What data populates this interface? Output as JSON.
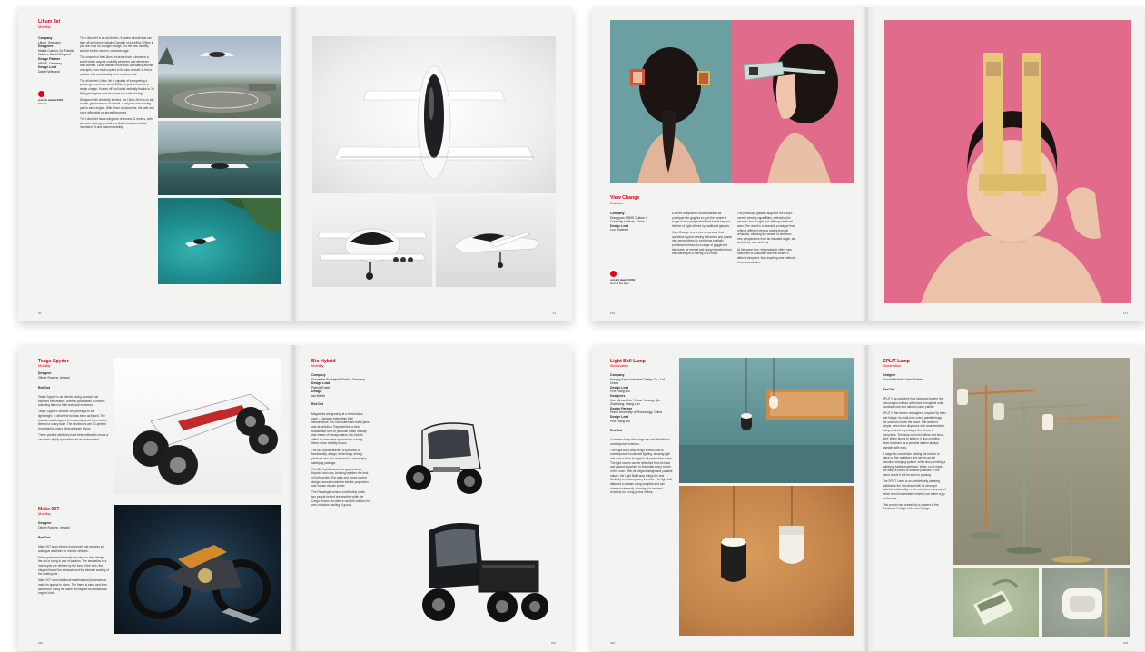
{
  "spreads": {
    "lilium": {
      "title": "Lilium Jet",
      "category": "Mobility",
      "meta": [
        {
          "label": "Company",
          "value": "Lilium, Germany"
        },
        {
          "label": "Designers",
          "value": "Mattia Cosson, Dr. Patrick Nathen, David Wiegand"
        },
        {
          "label": "Design Partner",
          "value": "HPWE, Germany"
        },
        {
          "label": "Design Lead",
          "value": "Daniel Wiegand"
        }
      ],
      "award": {
        "text": "red dot award 2019",
        "sub": "Mobility"
      },
      "paragraphs": [
        "The Lilium Jet is an all-electric, 5-seater aircraft that can take off and land vertically. Capable of travelling 300km in just one hour on a single charge, it is the new mobility service for the modern, urbanised age.",
        "The concept of the Lilium Jet arose from a dream of a world where anyone could fly wherever and whenever they wanted. Lilium wanted more than 36 rotating aircraft concepts, from multi-copters to tilt-rotor aircraft, to find a solution that could satisfy their requirements.",
        "The all-electric Lilium Jet is capable of transporting 4 passengers and one cover 300km in just an hour on a single charge. It takes off and lands vertically thanks to 36 tilting jet engines spread across two sets of wings.",
        "Designed with simplicity in mind, the Lilium Jet has no tail, rudder, gearboxes or oil circuits. It only has one moving part in each engine. With fewer components, the safe and more affordable an aircraft becomes.",
        "The Lilium Jet has a wingspan of around 11 metres, with two sets of wings providing a distinct look as well as increased lift and manoeuvrability."
      ],
      "folio_left": "40",
      "folio_right": "41"
    },
    "view_change": {
      "title": "View Change",
      "category": "Fashion",
      "meta": [
        {
          "label": "Company",
          "value": "Dongguan SWIIS Culture & Creativity Institute, China"
        },
        {
          "label": "Design Lead",
          "value": "Luo Shuzhen"
        }
      ],
      "award": {
        "text": "red dot award 2019",
        "sub": "best of the best"
      },
      "paragraphs_a": [
        "A series of eyewear conceptualised as prototype-like goggles to give the wearer a range of new perspectives that break beyond the line of sight offered by traditional glasses.",
        "View Change is a series of eyewear that questions typical viewing behaviour and grants new perspectives by combining spatially positioned mirrors. In a range of goggle-like structures for mental and design travelled from the challenges of seeing in a crowd."
      ],
      "paragraphs_b": [
        "The periscope glasses augment the body's normal viewing capabilities, extending the wearer's line of sight and offering additional axes. The result is a wearable prototype that reflects different viewing angles through refraction, allowing the wearer to see from new perspectives from an elevated angle, as well as the side and rear.",
        "At the same time, the prototype offers new observers to associate with the wearer's altered viewpoint, thus inspiring new methods of communication."
      ],
      "folio_left": "170",
      "folio_right": "171"
    },
    "mobility_concepts": {
      "items": [
        {
          "title": "Teage Spyder",
          "category": "Mobility",
          "meta": [
            {
              "label": "Designer",
              "value": "Olivier Rosenn, Ireland"
            }
          ],
          "red_dot": "Red Dot",
          "paragraphs": [
            "Teage Spyder is an electric racing concept that explores the creative, thermal possibilities of electric racketing taken to their technical extremes.",
            "Teage Spyder's number one priority is to be lightweight, in which the fun has been achieved. The chassis was designed to be aerodynamic from carbon fibre on a rotary base. The wishbones are 3D-printed from titanium using electron beam fusion.",
            "These positive attributes have been utilised to create a car that is highly specialised for its environment."
          ]
        },
        {
          "title": "Make 007",
          "category": "Mobility",
          "meta": [
            {
              "label": "Designer",
              "value": "Olivier Rosenn, Ireland"
            }
          ],
          "red_dot": "Red Dot",
          "paragraphs": [
            "Make 007 is an electric motorcycle that explores an analogue aesthetic for electric vehicles.",
            "Motorcycles are inherently evocative in their design, the act of riding is one of passion. The aesthetics of a motorcycle are defined by the form of the tank, the elegant flow of the exhausts and the intricate seating of the seating line.",
            "Make 007 uses traditional materials and processes to make its appeal to riders. The frame is sand cast from aluminium, using the same techniques as a traditional engine block."
          ]
        },
        {
          "title": "Bio-Hybrid",
          "category": "Mobility",
          "meta": [
            {
              "label": "Company",
              "value": "Schaeffler Bio-Hybrid GmbH, Germany"
            },
            {
              "label": "Design Lead",
              "value": "Patrick Endel"
            },
            {
              "label": "Design",
              "value": "Ian Martin"
            }
          ],
          "red_dot": "Red Dot",
          "paragraphs": [
            "Megacities are growing at a tremendous pace — typically faster than their infrastructure. For commuters are traffic jams and air pollution. Representing a new, sustainable form of personal urban mobility and means of transportation, Bio-Hybrid offers an innovative approach to solving these urban mobility issues.",
            "The Bio-Hybrid delivers a synthesis of functionality, design, technology, driving pleasure and zero emissions in one deeply satisfying package.",
            "The Bio-Hybrid closes the gap between bicycles and cars, bringing together the best of both worlds. The agile and space-saving design concept combines electric propulsion and human muscle power.",
            "The Passenger version comfortably seats two people behind one another while the Cargo version provides a variable solution for zero-emission hauling of goods."
          ]
        }
      ],
      "folio_left": "290",
      "folio_right": "291"
    },
    "lamps": {
      "items": [
        {
          "title": "Light Ball Lamp",
          "category": "Illumination",
          "meta": [
            {
              "label": "Company",
              "value": "Nanjing Faxin Industrial Design Co., Ltd., China"
            },
            {
              "label": "Design Lead",
              "value": "Prof. Yang Wu"
            },
            {
              "label": "Designers",
              "value": "Xue Minwei, Liu Yi, Luo Yuhang, Qiu Zhaohong, Wang Lan"
            },
            {
              "label": "Design Partner",
              "value": "Hohai University of Technology, China"
            },
            {
              "label": "Design Lead",
              "value": "Prof. Yang Wu"
            }
          ],
          "red_dot": "Red Dot",
          "paragraphs": [
            "A wireless lamp that brings fun and flexibility to contemporary interiors.",
            "The Light Ball Lamp brings a fresh look to contemporary household lighting, allowing light and colour to be brought to all parts of the home. The light source can be detached from its base and placed anywhere to illuminate every corner of the room. With its elegant design and portable nature, the Light Ball Lamp brings fun and flexibility to contemporary interiors. The light ball attaches to a base using magnets and can charged wirelessly, allowing it to be used remotely for a long period of time."
          ]
        },
        {
          "title": "SPLIT Lamp",
          "category": "Illumination",
          "meta": [
            {
              "label": "Designer",
              "value": "Ronald Mullett, United States"
            }
          ],
          "red_dot": "Red Dot",
          "paragraphs": [
            "SPLIT is an adaptive floor lamp and lantern that encourages outdoor adventure through its multi-functional use and natural colour palette.",
            "SPLIT is the lantern reimagined. Inspired by trees and foliage, its multi-tone colour palette brings the outdoors inside the home. The lantern's simple, hewn form disperses with ornamentation, using contrast to prototype the pieces it comprises. The lamp can hold diffuse and focus light. When lamps to lantern, it also provides three functions as a portable lantern always loseable with easy.",
            "A magnetic connection holding the lantern in place on the cantilever arm serves as the induction charging system, while also providing a satisfying tactile experience. When on its base, the lamp is meant to intuitive positions in the home where it will be seen in passing.",
            "The SPLIT Lamp is an aesthetically pleasing addition to the household with its clean yet tasteful functionality — the complementary use of which is not immediately evident, but rather a joy to discover.",
            "This project was created by a student at the Savannah College of Art and Design."
          ]
        }
      ],
      "folio_left": "318",
      "folio_right": "319"
    }
  },
  "colors": {
    "accent": "#e2001a",
    "paper": "#f3f3f2",
    "teal": "#6b9fa1",
    "pink": "#e06b8b",
    "ochre": "#c98a4a"
  }
}
